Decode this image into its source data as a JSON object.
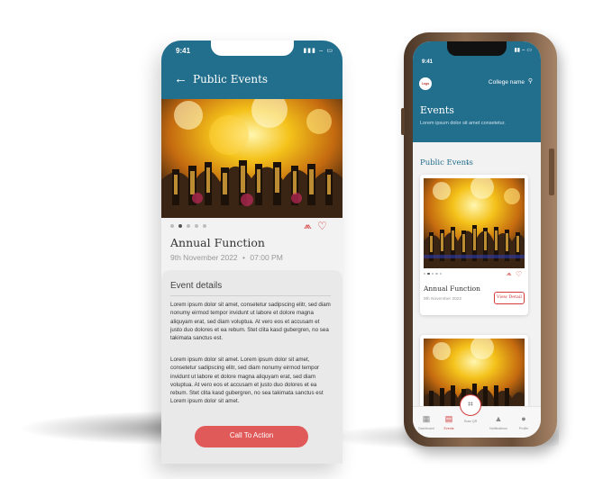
{
  "left_phone": {
    "time": "9:41",
    "status_icons": "▮▮▮ ⌢ ▭",
    "back_icon": "arrow-left-icon",
    "title": "Public Events",
    "carousel_dots": 5,
    "carousel_active": 1,
    "event_title": "Annual Function",
    "event_date": "9th November 2022",
    "event_time": "07:00 PM",
    "date_separator": "•",
    "details_heading": "Event details",
    "paragraph_1": "Lorem ipsum dolor sit amet, consetetur sadipscing elitr, sed diam nonumy eirmod tempor invidunt ut labore et dolore magna aliquyam erat, sed diam voluptua. At vero eos et accusam et justo duo dolores et ea rebum. Stet clita kasd gubergren, no sea takimata sanctus est.",
    "paragraph_2": "Lorem ipsum dolor sit amet. Lorem ipsum dolor sit amet, consetetur sadipscing elitr, sed diam nonumy eirmod tempor invidunt ut labore et dolore magna aliquyam erat, sed diam voluptua. At vero eos et accusam et justo duo dolores et ea rebum. Stet clita kasd gubergren, no sea takimata sanctus est Lorem ipsum dolor sit amet.",
    "cta_label": "Call To Action"
  },
  "right_phone": {
    "time": "9:41",
    "status_icons": "▮▮ ⌢ ▭",
    "logo_text": "Logo",
    "college_name": "College name",
    "header_title": "Events",
    "header_subtitle": "Lorem ipsum dolor sit amet consetetur.",
    "filter_label": "Public Events",
    "event_title": "Annual Function",
    "event_date": "9th November 2022",
    "view_detail_label": "View Detail",
    "tabs": [
      {
        "label": "Dashboard",
        "icon": "grid-icon",
        "glyph": "▦"
      },
      {
        "label": "Events",
        "icon": "calendar-icon",
        "glyph": "▤"
      },
      {
        "label": "Scan QR",
        "icon": "qr-scan-icon",
        "glyph": "⌗"
      },
      {
        "label": "Notifications",
        "icon": "bell-icon",
        "glyph": "▲"
      },
      {
        "label": "Profile",
        "icon": "user-icon",
        "glyph": "●"
      }
    ],
    "active_tab": "Events"
  },
  "colors": {
    "header_teal": "#226e8d",
    "accent_red": "#d33b3b",
    "cta_red": "#e15a5a",
    "background_gray": "#f2f2f2"
  }
}
